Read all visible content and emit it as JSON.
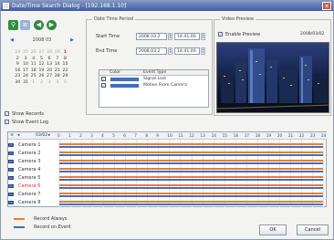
{
  "window": {
    "title": "Date/Time Search Dialog - [192.168.1.10]",
    "close_glyph": "✕"
  },
  "calendar": {
    "month_label": "2008 03",
    "rows": [
      [
        "24",
        "25",
        "26",
        "27",
        "28",
        "29",
        "1"
      ],
      [
        "2",
        "3",
        "4",
        "5",
        "6",
        "7",
        "8"
      ],
      [
        "9",
        "10",
        "11",
        "12",
        "13",
        "14",
        "15"
      ],
      [
        "16",
        "17",
        "18",
        "19",
        "20",
        "21",
        "22"
      ],
      [
        "23",
        "24",
        "25",
        "26",
        "27",
        "28",
        "29"
      ],
      [
        "30",
        "31",
        "1",
        "2",
        "3",
        "4",
        "5"
      ]
    ]
  },
  "options": {
    "show_records": "Show Records",
    "show_event_log": "Show Event Log"
  },
  "date_time_period": {
    "label": "Date Time Period",
    "start_label": "Start Time",
    "start_date": "2008 03 2",
    "start_time": "14:41:00",
    "end_label": "End Time",
    "end_date": "2008 03 2",
    "end_time": "14:41:00"
  },
  "event_table": {
    "headers": [
      "Color",
      "Event Type"
    ],
    "rows": [
      {
        "type": "Signal Lost",
        "color": "#3f6fc0"
      },
      {
        "type": "Motion From Camera",
        "color": "#3f6fc0"
      }
    ]
  },
  "video_preview": {
    "label": "Video Preview",
    "enable_label": "Enable Preview",
    "timestamp": "2008/03/02"
  },
  "timeline": {
    "date_label": "03/02",
    "hours": [
      "0",
      "1",
      "2",
      "3",
      "4",
      "5",
      "6",
      "7",
      "8",
      "9",
      "10",
      "11",
      "12",
      "13",
      "14",
      "15",
      "16",
      "17",
      "18",
      "19",
      "20",
      "21",
      "22",
      "23",
      "24"
    ],
    "cameras": [
      "Camera 1",
      "Camera 2",
      "Camera 3",
      "Camera 4",
      "Camera 5",
      "Camera 6",
      "Camera 7",
      "Camera 8"
    ],
    "selected_camera": "Camera 6",
    "colors": {
      "record": "#ec7c2f",
      "event": "#3f6fc0"
    }
  },
  "legend": {
    "record_always": "Record Always",
    "record_on_event": "Record on Event"
  },
  "buttons": {
    "ok": "OK",
    "cancel": "Cancel"
  }
}
